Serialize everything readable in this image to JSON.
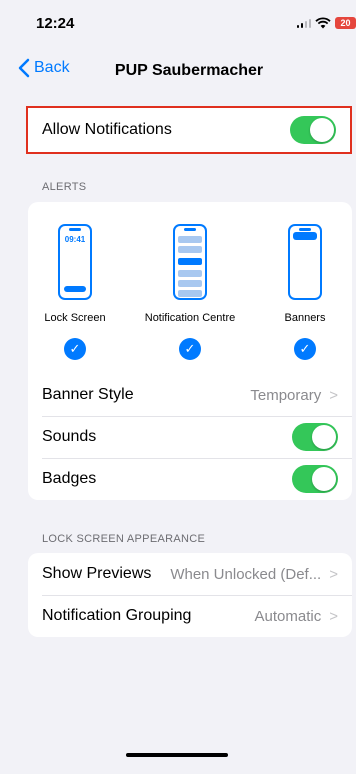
{
  "status_bar": {
    "time": "12:24",
    "battery": "20"
  },
  "nav": {
    "back_label": "Back",
    "title": "PUP Saubermacher"
  },
  "allow_notifications": {
    "label": "Allow Notifications",
    "enabled": true
  },
  "alerts": {
    "header": "ALERTS",
    "styles": [
      {
        "label": "Lock Screen",
        "preview_time": "09:41",
        "checked": true
      },
      {
        "label": "Notification Centre",
        "checked": true
      },
      {
        "label": "Banners",
        "checked": true
      }
    ],
    "banner_style": {
      "label": "Banner Style",
      "value": "Temporary"
    },
    "sounds": {
      "label": "Sounds",
      "enabled": true
    },
    "badges": {
      "label": "Badges",
      "enabled": true
    }
  },
  "lock_screen_appearance": {
    "header": "LOCK SCREEN APPEARANCE",
    "show_previews": {
      "label": "Show Previews",
      "value": "When Unlocked (Def..."
    },
    "notification_grouping": {
      "label": "Notification Grouping",
      "value": "Automatic"
    }
  },
  "colors": {
    "accent": "#007aff",
    "toggle_on": "#34c759",
    "highlight": "#e0301e"
  }
}
